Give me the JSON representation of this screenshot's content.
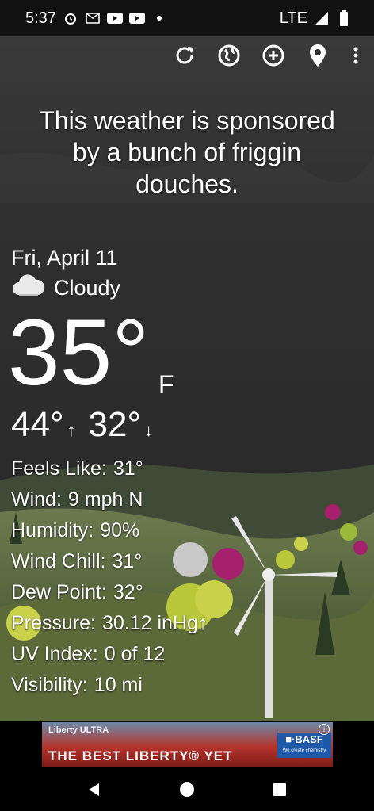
{
  "status_bar": {
    "time": "5:37",
    "network": "LTE",
    "icons": [
      "alarm-icon",
      "gmail-icon",
      "youtube-icon",
      "youtube-icon",
      "dot-icon",
      "signal-icon",
      "battery-icon"
    ]
  },
  "toolbar": {
    "icons": [
      "refresh-icon",
      "earth-icon",
      "add-icon",
      "location-icon",
      "more-vert-icon"
    ]
  },
  "sponsor_text": "This weather is sponsored by a bunch of friggin douches.",
  "date": "Fri, April 11",
  "condition": "Cloudy",
  "temperature": "35°",
  "unit": "F",
  "high": "44°",
  "low": "32°",
  "details": [
    {
      "label": "Feels Like:",
      "value": "31°"
    },
    {
      "label": "Wind:",
      "value": "9 mph N"
    },
    {
      "label": "Humidity:",
      "value": "90%"
    },
    {
      "label": "Wind Chill:",
      "value": "31°"
    },
    {
      "label": "Dew Point:",
      "value": "32°"
    },
    {
      "label": "Pressure:",
      "value": "30.12 inHg↑"
    },
    {
      "label": "UV Index:",
      "value": "0 of 12"
    },
    {
      "label": "Visibility:",
      "value": "10 mi"
    }
  ],
  "ad": {
    "brand": "Liberty ULTRA",
    "headline": "THE BEST LIBERTY® YET",
    "advertiser": "■·BASF",
    "tagline": "We create chemistry",
    "info_glyph": "i"
  },
  "colors": {
    "status_bar": "#111111",
    "background": "#2a2a2a",
    "ad_logo": "#1d59a8",
    "nav_bar": "#000000"
  }
}
